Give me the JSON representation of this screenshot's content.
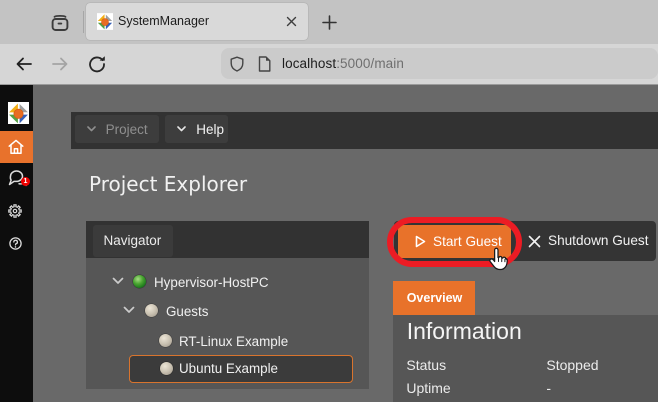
{
  "browser": {
    "tab": {
      "title": "SystemManager"
    },
    "url": {
      "host": "localhost",
      "path": ":5000/main"
    }
  },
  "app": {
    "menubar": {
      "project_label": "Project",
      "help_label": "Help"
    },
    "page_title": "Project Explorer",
    "navigator": {
      "title": "Navigator",
      "tree": [
        {
          "label": "Hypervisor-HostPC",
          "depth": 0,
          "expanded": true,
          "status_color": "#2e8b2e",
          "selected": false
        },
        {
          "label": "Guests",
          "depth": 1,
          "expanded": true,
          "status_color": "#c4bcae",
          "selected": false
        },
        {
          "label": "RT-Linux Example",
          "depth": 2,
          "expanded": false,
          "status_color": "#c4bcae",
          "selected": false
        },
        {
          "label": "Ubuntu Example",
          "depth": 2,
          "expanded": false,
          "status_color": "#c4bcae",
          "selected": true
        }
      ]
    },
    "actions": {
      "start_label": "Start Guest",
      "shutdown_label": "Shutdown Guest"
    },
    "tabs": [
      {
        "label": "Overview",
        "active": true
      }
    ],
    "info": {
      "heading": "Information",
      "rows": [
        {
          "label": "Status",
          "value": "Stopped"
        },
        {
          "label": "Uptime",
          "value": "-"
        }
      ]
    },
    "sidebar_badge": "1",
    "colors": {
      "accent_orange": "#e8722a",
      "annotation_red": "#ec1c24",
      "panel_dark": "#565656",
      "bar_dark": "#323232"
    }
  }
}
